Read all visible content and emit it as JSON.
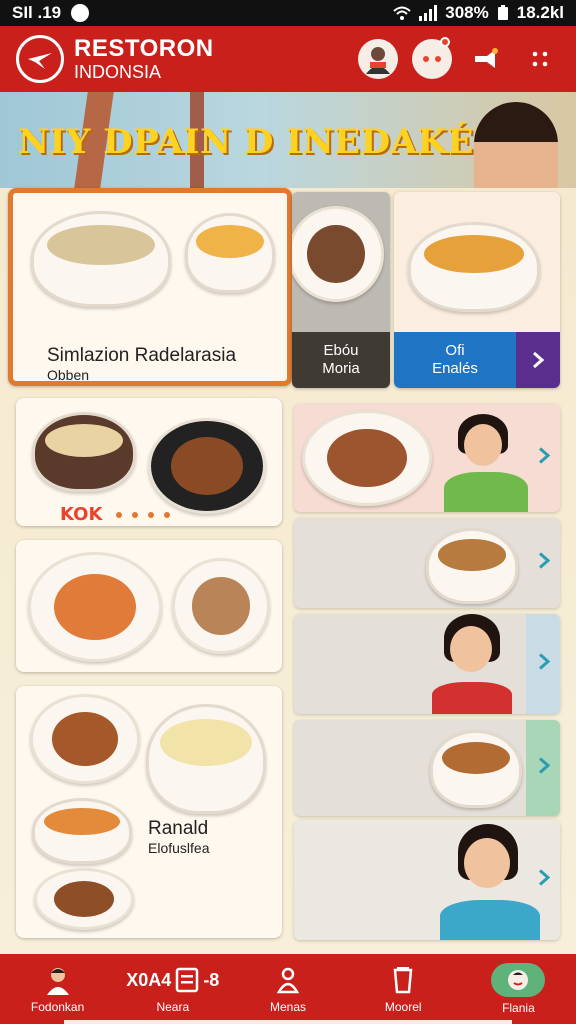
{
  "status_bar": {
    "left_text": "SIl .19",
    "battery": "308%",
    "time": "18.2kl"
  },
  "app_bar": {
    "brand_line1": "RESTORON",
    "brand_line2": "INDONSIA",
    "icons": [
      "logo-icon",
      "avatar-icon",
      "notification-avatar-icon",
      "share-icon",
      "more-icon"
    ]
  },
  "hero": {
    "title": "NIY DPAIN D INEDAKÉIN"
  },
  "grid": {
    "featured": {
      "title": "Simlazion Radelarasia",
      "subtitle": "Obben"
    },
    "tile_grey": {
      "line1": "Ebóu",
      "line2": "Moria"
    },
    "tile_blue": {
      "line1": "Ofi",
      "line2": "Enalés"
    },
    "card_soup_badge": "KOK",
    "card_platter_title": "Ranald",
    "card_platter_subtitle": "Elofuslfea"
  },
  "nav": {
    "items": [
      {
        "label": "Fodonkan",
        "icon": "person-icon"
      },
      {
        "label": "Neara",
        "icon": "menu-list-icon",
        "extra": "X0A4",
        "extra2": "-8"
      },
      {
        "label": "Menas",
        "icon": "user-icon"
      },
      {
        "label": "Moorel",
        "icon": "cup-icon"
      },
      {
        "label": "Flania",
        "icon": "face-icon"
      }
    ]
  },
  "colors": {
    "brand_red": "#c9201c",
    "accent_orange": "#e07a30",
    "tile_blue": "#1f75c4",
    "nav_active": "#5fb27a"
  }
}
